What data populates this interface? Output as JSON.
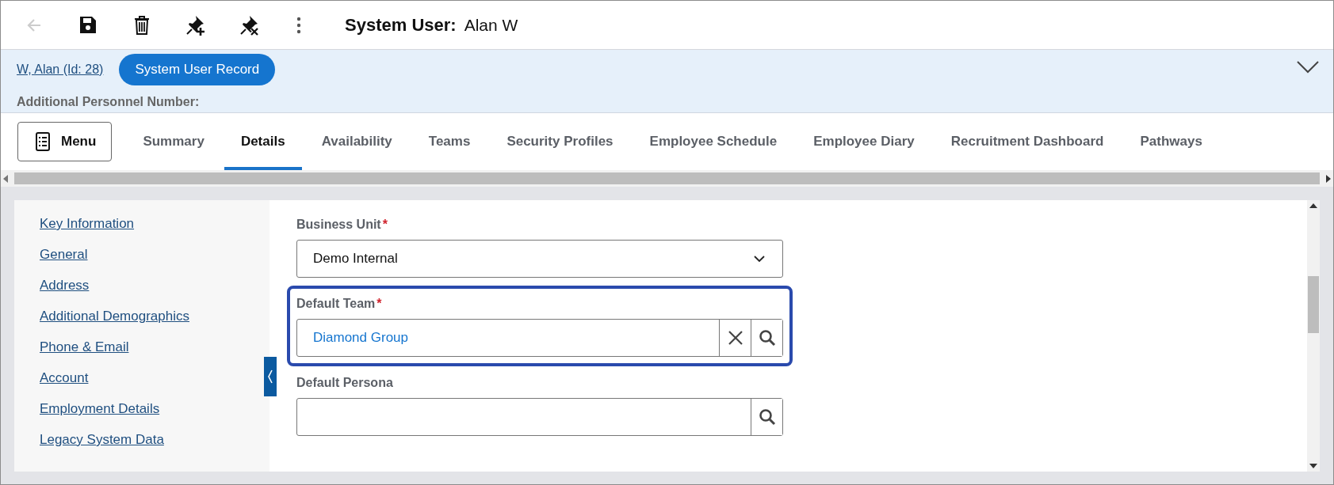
{
  "toolbar": {
    "buttons": [
      {
        "kind": "back",
        "disabled": true
      },
      {
        "kind": "save",
        "disabled": false
      },
      {
        "kind": "delete",
        "disabled": false
      },
      {
        "kind": "pin-add",
        "disabled": false
      },
      {
        "kind": "pin-remove",
        "disabled": false
      },
      {
        "kind": "more",
        "disabled": false
      }
    ],
    "title_label": "System User:",
    "title_value": "Alan W"
  },
  "header": {
    "record_link": "W, Alan (Id: 28)",
    "badge": "System User Record",
    "field_label": "Additional Personnel Number:",
    "expanded": false
  },
  "tabs": {
    "menu_label": "Menu",
    "items": [
      {
        "label": "Summary",
        "selected": false
      },
      {
        "label": "Details",
        "selected": true
      },
      {
        "label": "Availability",
        "selected": false
      },
      {
        "label": "Teams",
        "selected": false
      },
      {
        "label": "Security Profiles",
        "selected": false
      },
      {
        "label": "Employee Schedule",
        "selected": false
      },
      {
        "label": "Employee Diary",
        "selected": false
      },
      {
        "label": "Recruitment Dashboard",
        "selected": false
      },
      {
        "label": "Pathways",
        "selected": false
      }
    ]
  },
  "sidebar": {
    "items": [
      "Key Information",
      "General",
      "Address",
      "Additional Demographics",
      "Phone & Email",
      "Account",
      "Employment Details",
      "Legacy System Data"
    ]
  },
  "form": {
    "fields": [
      {
        "kind": "select",
        "label": "Business Unit",
        "required_mark": "*",
        "highlighted": false,
        "value": "Demo Internal"
      },
      {
        "kind": "lookup",
        "label": "Default Team",
        "required_mark": "*",
        "highlighted": true,
        "value": "Diamond Group"
      },
      {
        "kind": "lookup",
        "label": "Default Persona",
        "highlighted": false
      }
    ]
  }
}
